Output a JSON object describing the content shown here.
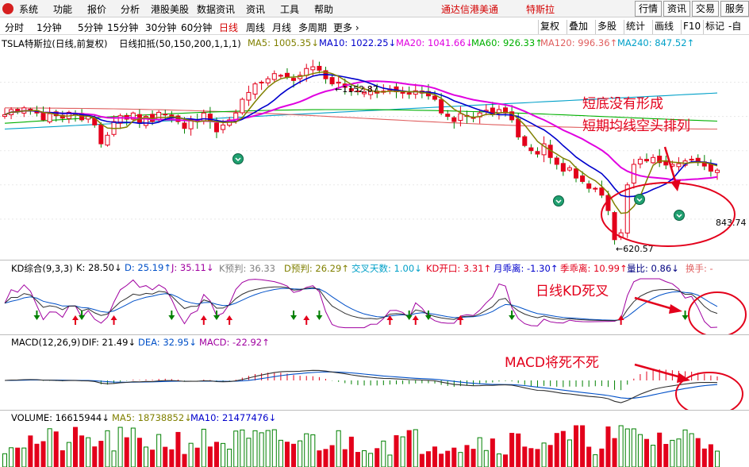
{
  "menubar": {
    "items": [
      "系统",
      "功能",
      "报价",
      "分析",
      "港股美股",
      "数据资讯",
      "资讯",
      "工具",
      "帮助"
    ],
    "brand": "通达信港美通",
    "stock_name": "特斯拉",
    "right_buttons": [
      "行情",
      "资讯",
      "交易",
      "服务"
    ]
  },
  "tabbar": {
    "tabs": [
      "分时",
      "1分钟",
      "5分钟",
      "15分钟",
      "30分钟",
      "60分钟",
      "日线",
      "周线",
      "月线",
      "多周期",
      "更多 ›"
    ],
    "active_index": 6,
    "right_tabs": [
      "复权",
      "叠加",
      "多股",
      "统计",
      "画线",
      "F10",
      "标记",
      "-自选"
    ]
  },
  "legend": {
    "main_title": "TSLA特斯拉(日线,前复权)",
    "indicator": "日线扣抵(50,150,200,1,1,1)",
    "ma5": "MA5: 1005.35↓",
    "ma10": "MA10: 1022.25↓",
    "ma20": "MA20: 1041.66↓",
    "ma60": "MA60: 926.33↑",
    "ma120": "MA120: 996.36↑",
    "ma240": "MA240: 847.52↑"
  },
  "colors": {
    "up": "#e3001b",
    "down": "#008000",
    "ma5": "#808000",
    "ma10": "#0000cc",
    "ma20": "#e000e0",
    "ma60": "#00b000",
    "ma120": "#e06060",
    "ma240": "#00a0c8"
  },
  "kd": {
    "title": "KD综合(9,3,3)",
    "k": "K: 28.50↓",
    "d": "D: 25.19↑",
    "j": "J: 35.11↓",
    "k_pred": "K预判: 36.33",
    "d_pred": "D预判: 26.29↑",
    "cross_days": "交叉天数: 1.00↓",
    "kd_open": "KD开口: 3.31↑",
    "month_dev": "月乖离: -1.30↑",
    "season_dev": "季乖离: 10.99↑",
    "vol_ratio": "量比: 0.86↓",
    "turnover": "换手: -"
  },
  "macd": {
    "title": "MACD(12,26,9)",
    "dif": "DIF: 21.49↓",
    "dea": "DEA: 32.95↓",
    "macd": "MACD: -22.92↑"
  },
  "volume": {
    "title": "VOLUME: 16615944↓",
    "ma5": "MA5: 18738852↓",
    "ma10": "MA10: 21477476↓"
  },
  "price_labels": {
    "high": "1152.87",
    "low": "620.57",
    "last": "843.74"
  },
  "annotations": {
    "main_line1": "短底没有形成",
    "main_line2": "短期均线空头排列",
    "kd": "日线KD死叉",
    "macd": "MACD将死不死"
  },
  "chart_data": {
    "type": "candlestick",
    "series_close": [
      1005,
      1020,
      1015,
      1025,
      1018,
      1010,
      990,
      1008,
      1002,
      995,
      1012,
      1005,
      990,
      1000,
      975,
      920,
      945,
      985,
      1002,
      992,
      1010,
      980,
      1000,
      985,
      1012,
      1005,
      995,
      985,
      965,
      990,
      985,
      1010,
      985,
      955,
      975,
      990,
      1010,
      1050,
      1070,
      1095,
      1100,
      1110,
      1125,
      1120,
      1115,
      1105,
      1120,
      1140,
      1145,
      1135,
      1110,
      1095,
      1100,
      1085,
      1075,
      1072,
      1070,
      1075,
      1068,
      1074,
      1080,
      1072,
      1070,
      1065,
      1075,
      1068,
      1060,
      1050,
      1010,
      1000,
      985,
      1008,
      1000,
      995,
      1010,
      1018,
      1005,
      1020,
      1010,
      990,
      940,
      915,
      900,
      890,
      920,
      880,
      860,
      840,
      850,
      820,
      810,
      790,
      790,
      770,
      725,
      640,
      660,
      800,
      860,
      875,
      870,
      880,
      865,
      858,
      860,
      862,
      870,
      875,
      865,
      855,
      840,
      843
    ]
  }
}
